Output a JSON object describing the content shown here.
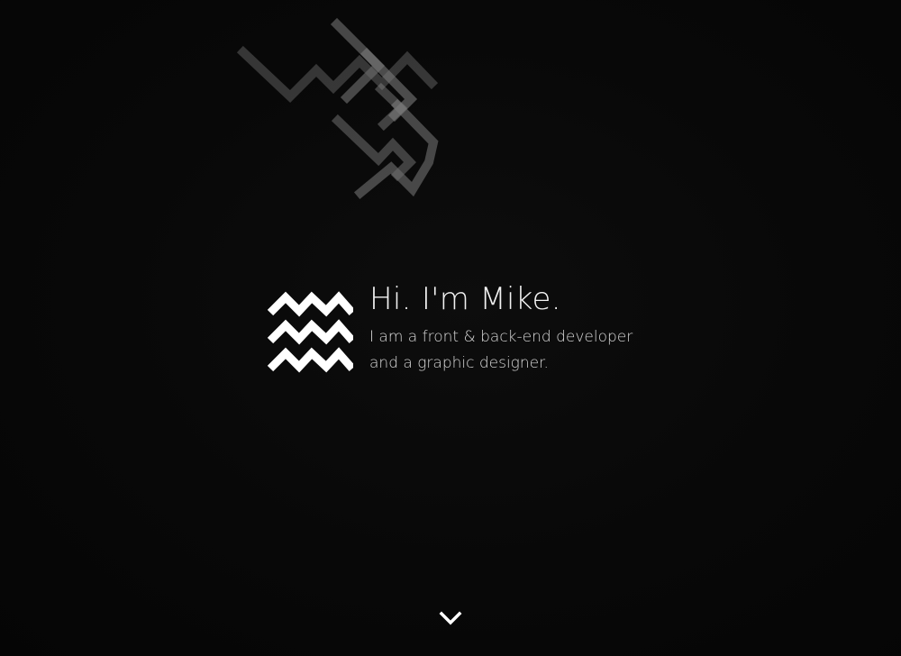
{
  "hero": {
    "title": "Hi. I'm Mike.",
    "line1": "I am a front & back-end developer",
    "line2": "and a graphic designer."
  },
  "icons": {
    "logo": "triple-zigzag-logo",
    "scroll": "chevron-down-icon",
    "background": "geometric-line-pattern"
  },
  "colors": {
    "background": "#070707",
    "text": "#f2f2f2",
    "subtext": "#d8d8d8",
    "lines": "#6a6a6a"
  }
}
